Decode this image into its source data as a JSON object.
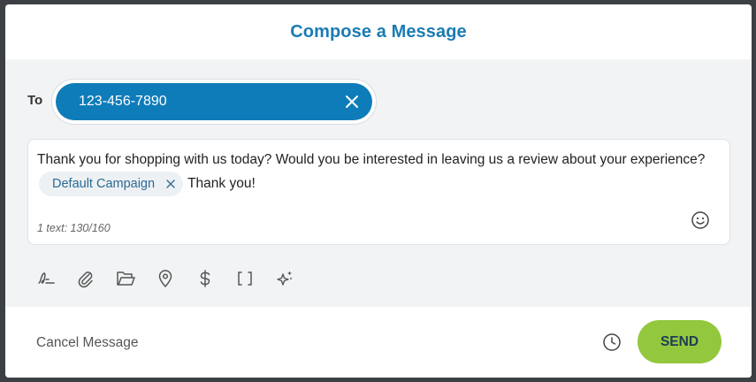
{
  "dialog": {
    "title": "Compose a Message"
  },
  "recipient": {
    "label": "To",
    "phone": "123-456-7890"
  },
  "message": {
    "text": "Thank you for shopping with us today? Would you be interested in leaving us a review about your experience?",
    "campaign_chip": "Default Campaign",
    "closing": "Thank you!",
    "counter": "1 text: 130/160"
  },
  "toolbar": {
    "icons": [
      "signature-icon",
      "attachment-icon",
      "folder-icon",
      "location-icon",
      "dollar-icon",
      "brackets-icon",
      "ai-sparkle-icon"
    ]
  },
  "footer": {
    "cancel_label": "Cancel Message",
    "send_label": "SEND"
  },
  "colors": {
    "title": "#1b7cb3",
    "recipient_chip": "#0f7cba",
    "send_button": "#93c83e",
    "panel_bg": "#f2f3f4"
  }
}
